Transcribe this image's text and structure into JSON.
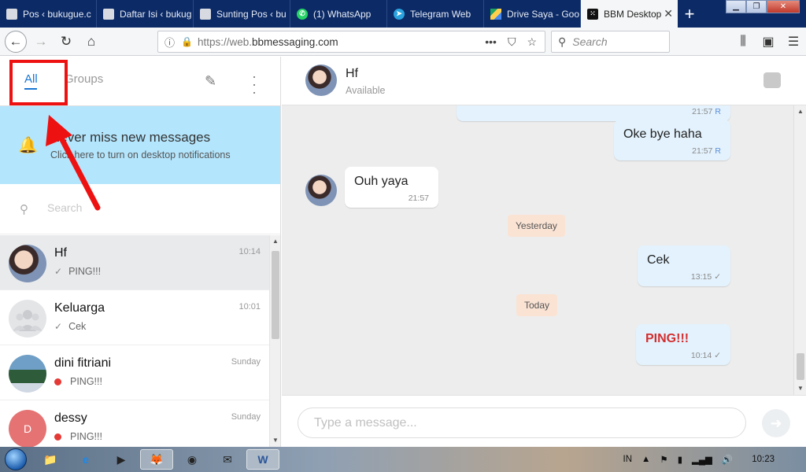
{
  "browser": {
    "tabs": [
      {
        "label": "Pos ‹ bukugue.c",
        "icon": "doc"
      },
      {
        "label": "Daftar Isi ‹ bukug",
        "icon": "doc"
      },
      {
        "label": "Sunting Pos ‹ bu",
        "icon": "doc"
      },
      {
        "label": "(1) WhatsApp",
        "icon": "whatsapp"
      },
      {
        "label": "Telegram Web",
        "icon": "telegram"
      },
      {
        "label": "Drive Saya - Goo",
        "icon": "google-drive"
      },
      {
        "label": "BBM Desktop",
        "icon": "bbm",
        "active": true
      }
    ],
    "url_prefix": "https://web.",
    "url_domain": "bbmessaging.com",
    "search_placeholder": "Search"
  },
  "sidebar": {
    "tab_all": "All",
    "tab_groups": "Groups",
    "notification_title": "Never miss new messages",
    "notification_sub": "Click here to turn on desktop notifications",
    "search_placeholder": "Search",
    "chats": [
      {
        "name": "Hf",
        "time": "10:14",
        "preview": "PING!!!",
        "status": "read-check"
      },
      {
        "name": "Keluarga",
        "time": "10:01",
        "preview": "Cek",
        "status": "read-check"
      },
      {
        "name": "dini fitriani",
        "time": "Sunday",
        "preview": "PING!!!",
        "status": "red-dot"
      },
      {
        "name": "dessy",
        "time": "Sunday",
        "preview": "PING!!!",
        "status": "red-dot",
        "initial": "D"
      }
    ]
  },
  "conversation": {
    "name": "Hf",
    "status": "Available",
    "messages": [
      {
        "dir": "out",
        "text": "",
        "time": "21:57",
        "receipt": "R"
      },
      {
        "dir": "out",
        "text": "Oke bye haha",
        "time": "21:57",
        "receipt": "R"
      },
      {
        "dir": "in",
        "text": "Ouh yaya",
        "time": "21:57"
      },
      {
        "dir": "divider",
        "text": "Yesterday"
      },
      {
        "dir": "out",
        "text": "Cek",
        "time": "13:15",
        "receipt": "✓"
      },
      {
        "dir": "divider",
        "text": "Today"
      },
      {
        "dir": "out",
        "text": "PING!!!",
        "time": "10:14",
        "receipt": "✓"
      }
    ],
    "composer_placeholder": "Type a message..."
  },
  "taskbar": {
    "lang": "IN",
    "clock": "10:23"
  },
  "colors": {
    "accent": "#1976d2",
    "notification_bg": "#b3e5fc",
    "annotation": "#ee1111",
    "ping": "#d32f2f"
  }
}
